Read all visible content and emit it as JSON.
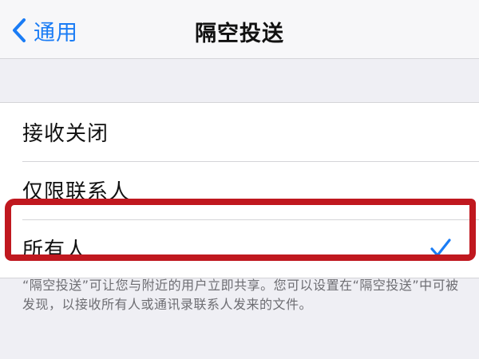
{
  "nav": {
    "back_label": "通用",
    "title": "隔空投送"
  },
  "options": [
    {
      "label": "接收关闭",
      "selected": false
    },
    {
      "label": "仅限联系人",
      "selected": false
    },
    {
      "label": "所有人",
      "selected": true
    }
  ],
  "footer_text": "“隔空投送”可让您与附近的用户立即共享。您可以设置在“隔空投送”中可被发现，以接收所有人或通讯录联系人发来的文件。",
  "colors": {
    "accent": "#1a7cf5",
    "highlight": "#c0181f",
    "background": "#efeff4"
  }
}
